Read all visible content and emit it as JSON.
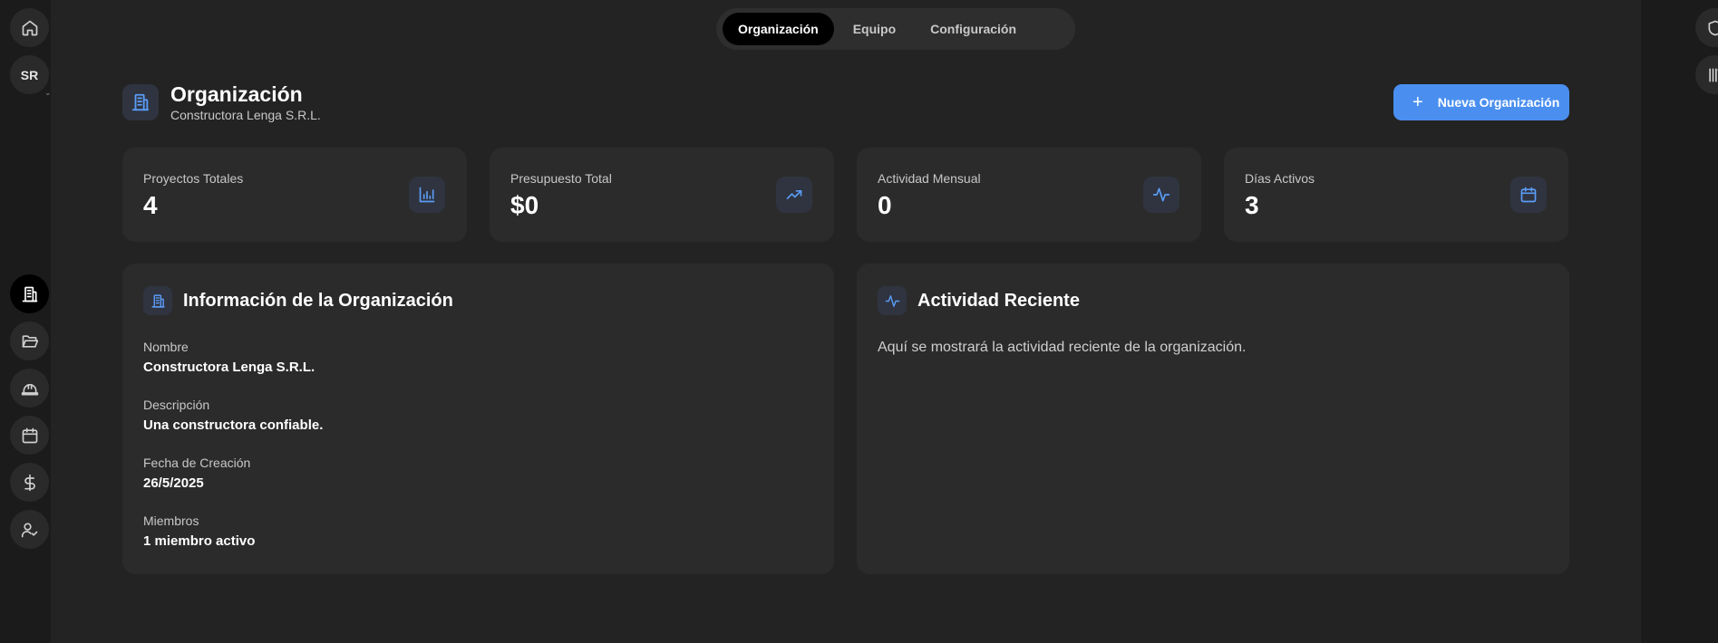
{
  "sidebar": {
    "avatar_initials": "SR",
    "items": [
      {
        "name": "home",
        "icon": "home-icon"
      },
      {
        "name": "organization",
        "icon": "building-icon",
        "active": true
      },
      {
        "name": "projects",
        "icon": "folder-open-icon"
      },
      {
        "name": "construction",
        "icon": "hard-hat-icon"
      },
      {
        "name": "calendar",
        "icon": "calendar-icon"
      },
      {
        "name": "finances",
        "icon": "dollar-icon"
      },
      {
        "name": "users",
        "icon": "user-check-icon"
      }
    ]
  },
  "right_rail": {
    "items": [
      {
        "name": "shield",
        "icon": "shield-icon"
      },
      {
        "name": "library",
        "icon": "library-icon"
      }
    ]
  },
  "tabs": [
    {
      "label": "Organización",
      "active": true
    },
    {
      "label": "Equipo",
      "active": false
    },
    {
      "label": "Configuración",
      "active": false
    }
  ],
  "header": {
    "title": "Organización",
    "subtitle": "Constructora Lenga S.R.L.",
    "new_button_label": "Nueva Organización"
  },
  "stats": [
    {
      "label": "Proyectos Totales",
      "value": "4",
      "icon": "bar-chart-icon"
    },
    {
      "label": "Presupuesto Total",
      "value": "$0",
      "icon": "trending-up-icon"
    },
    {
      "label": "Actividad Mensual",
      "value": "0",
      "icon": "activity-icon"
    },
    {
      "label": "Días Activos",
      "value": "3",
      "icon": "calendar-icon"
    }
  ],
  "info_panel": {
    "title": "Información de la Organización",
    "fields": [
      {
        "label": "Nombre",
        "value": "Constructora Lenga S.R.L."
      },
      {
        "label": "Descripción",
        "value": "Una constructora confiable."
      },
      {
        "label": "Fecha de Creación",
        "value": "26/5/2025"
      },
      {
        "label": "Miembros",
        "value": "1 miembro activo"
      }
    ]
  },
  "activity_panel": {
    "title": "Actividad Reciente",
    "text": "Aquí se mostrará la actividad reciente de la organización."
  },
  "colors": {
    "accent": "#4a8ff0",
    "icon_accent": "#5b9cf6",
    "background": "#232323",
    "card": "#2b2b2b"
  }
}
